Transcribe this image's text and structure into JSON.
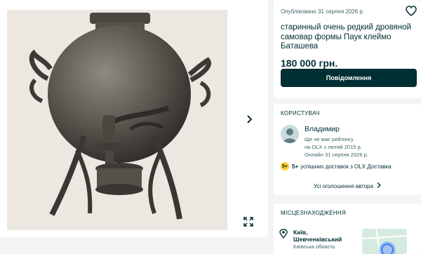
{
  "gallery": {
    "next_icon": "chevron-right-icon",
    "expand_icon": "expand-icon"
  },
  "ad": {
    "published": "Опубліковано 31 серпня 2026 р.",
    "title": "старинный очень редкий дровяной самовар формы Паук клеймо Баташева",
    "price": "180 000 грн.",
    "message_button": "Повідомлення",
    "favorite_icon": "heart-icon"
  },
  "user": {
    "section_title": "КОРИСТУВАЧ",
    "name": "Владимир",
    "rating": "Ще не має рейтингу",
    "member_since": "на OLX з лютий 2015 р.",
    "last_online": "Онлайн 31 серпня 2026 р.",
    "delivery_badge": "5+",
    "delivery_count": "5+",
    "delivery_text": "успішних доставок з OLX Доставка",
    "all_ads": "Усі оголошення автора"
  },
  "location": {
    "section_title": "МІСЦЕЗНАХОДЖЕННЯ",
    "city": "Київ,",
    "district": "Шевченківський",
    "region": "Київська область"
  },
  "colors": {
    "brand_dark": "#002f34",
    "page_bg": "#f2f4f5",
    "delivery_yellow": "#ffce32"
  }
}
